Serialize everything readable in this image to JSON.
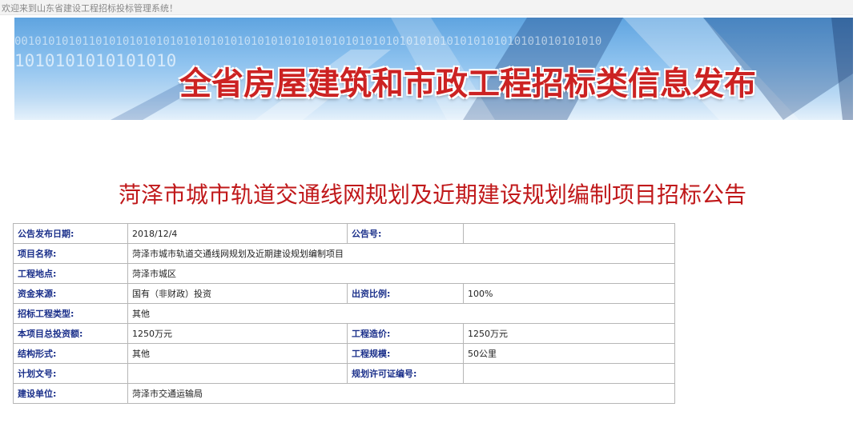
{
  "top_bar": {
    "welcome": "欢迎来到山东省建设工程招标投标管理系统！"
  },
  "banner": {
    "title": "全省房屋建筑和市政工程招标类信息发布",
    "binary_row_1": "001010101011010101010101010101010101010101010101010101010101010101010101010101010101010",
    "binary_row_2": "1010101010101010"
  },
  "announcement_title": "菏泽市城市轨道交通线网规划及近期建设规划编制项目招标公告",
  "info_table": {
    "publish_date_label": "公告发布日期:",
    "publish_date": "2018/12/4",
    "notice_no_label": "公告号:",
    "notice_no": "",
    "project_name_label": "项目名称:",
    "project_name": "菏泽市城市轨道交通线网规划及近期建设规划编制项目",
    "location_label": "工程地点:",
    "location": "菏泽市城区",
    "fund_source_label": "资金来源:",
    "fund_source": "国有（非财政）投资",
    "fund_ratio_label": "出资比例:",
    "fund_ratio": "100%",
    "tender_type_label": "招标工程类型:",
    "tender_type": "其他",
    "total_investment_label": "本项目总投资额:",
    "total_investment": "1250万元",
    "cost_label": "工程造价:",
    "cost": "1250万元",
    "structure_label": "结构形式:",
    "structure": "其他",
    "scale_label": "工程规模:",
    "scale": "50公里",
    "plan_doc_label": "计划文号:",
    "plan_doc": "",
    "permit_no_label": "规划许可证编号:",
    "permit_no": "",
    "builder_label": "建设单位:",
    "builder": "菏泽市交通运输局"
  }
}
